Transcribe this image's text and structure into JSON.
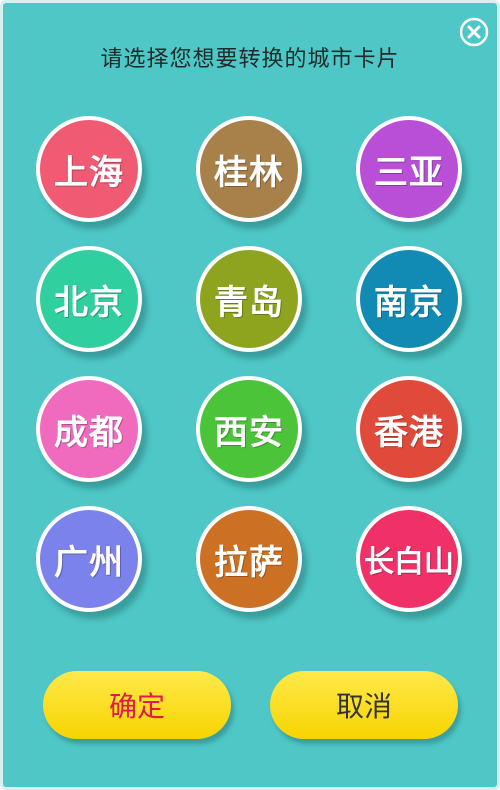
{
  "header": {
    "title": "请选择您想要转换的城市卡片",
    "close_icon": "close-circle-icon"
  },
  "cities": [
    {
      "label": "上海",
      "color": "#f15a73"
    },
    {
      "label": "桂林",
      "color": "#a8804a"
    },
    {
      "label": "三亚",
      "color": "#b94fd6"
    },
    {
      "label": "北京",
      "color": "#2fcf9f"
    },
    {
      "label": "青岛",
      "color": "#8ea31e"
    },
    {
      "label": "南京",
      "color": "#118ab4"
    },
    {
      "label": "成都",
      "color": "#f06bbd"
    },
    {
      "label": "西安",
      "color": "#4bc43a"
    },
    {
      "label": "香港",
      "color": "#df4a3a"
    },
    {
      "label": "广州",
      "color": "#7c82ec"
    },
    {
      "label": "拉萨",
      "color": "#cc7124"
    },
    {
      "label": "长白山",
      "color": "#ef3168"
    }
  ],
  "actions": {
    "confirm_label": "确定",
    "confirm_color": "#e01a4f",
    "cancel_label": "取消",
    "cancel_color": "#333333",
    "button_color": "#ffe213"
  },
  "colors": {
    "background": "#4fc7c7",
    "circle_border": "#ffffff"
  }
}
